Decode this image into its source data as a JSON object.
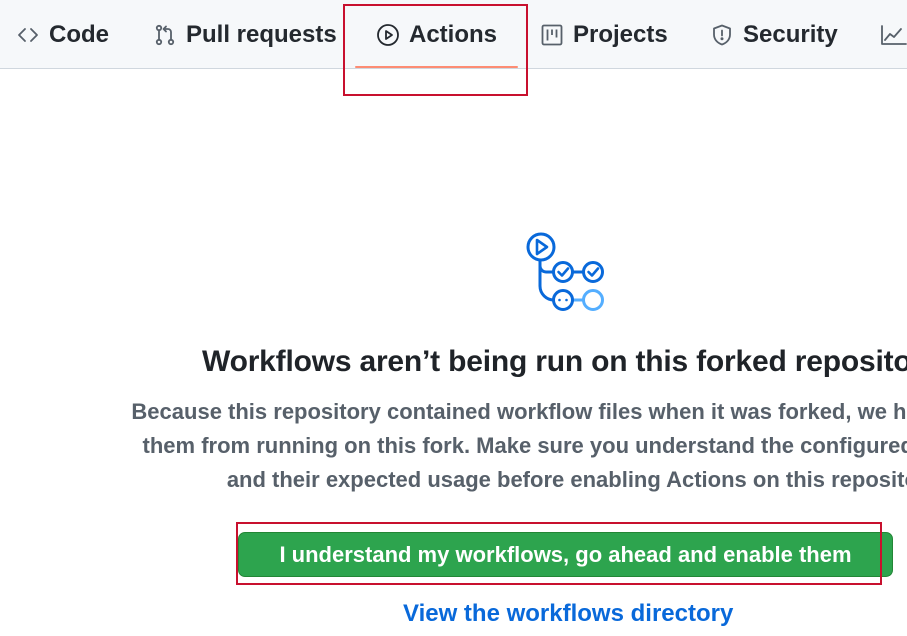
{
  "nav": {
    "tabs": [
      {
        "label": "Code",
        "icon": "code-icon"
      },
      {
        "label": "Pull requests",
        "icon": "git-pull-request-icon"
      },
      {
        "label": "Actions",
        "icon": "play-circle-icon",
        "active": true
      },
      {
        "label": "Projects",
        "icon": "project-table-icon"
      },
      {
        "label": "Security",
        "icon": "shield-icon"
      },
      {
        "label": "",
        "icon": "graph-icon"
      }
    ]
  },
  "blankslate": {
    "icon": "workflow-illustration-icon",
    "title": "Workflows aren’t being run on this forked repository",
    "description_lines": [
      "Because this repository contained workflow files when it was forked, we have disabled",
      "them from running on this fork. Make sure you understand the configured workflows",
      "and their expected usage before enabling Actions on this repository."
    ],
    "enable_button_label": "I understand my workflows, go ahead and enable them",
    "directory_link_label": "View the workflows directory"
  },
  "colors": {
    "accent_underline": "#fd8c73",
    "primary_button": "#2da44e",
    "link": "#0969da",
    "annotation": "#c8102e"
  }
}
